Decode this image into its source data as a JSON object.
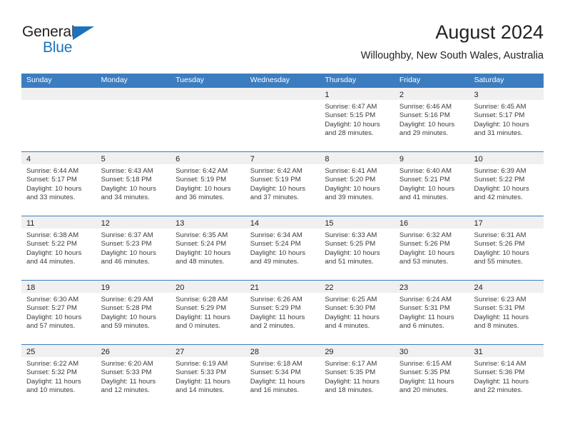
{
  "brand": {
    "name_top": "General",
    "name_bottom": "Blue",
    "accent_color": "#1c72bd"
  },
  "header": {
    "title": "August 2024",
    "subtitle": "Willoughby, New South Wales, Australia"
  },
  "theme": {
    "header_blue": "#3c7dc0",
    "day_band_gray": "#f0f0f0",
    "text_color": "#231f20"
  },
  "weekdays": [
    "Sunday",
    "Monday",
    "Tuesday",
    "Wednesday",
    "Thursday",
    "Friday",
    "Saturday"
  ],
  "weeks": [
    [
      {
        "day": "",
        "empty": true
      },
      {
        "day": "",
        "empty": true
      },
      {
        "day": "",
        "empty": true
      },
      {
        "day": "",
        "empty": true
      },
      {
        "day": "1",
        "sunrise": "Sunrise: 6:47 AM",
        "sunset": "Sunset: 5:15 PM",
        "daylight_1": "Daylight: 10 hours",
        "daylight_2": "and 28 minutes."
      },
      {
        "day": "2",
        "sunrise": "Sunrise: 6:46 AM",
        "sunset": "Sunset: 5:16 PM",
        "daylight_1": "Daylight: 10 hours",
        "daylight_2": "and 29 minutes."
      },
      {
        "day": "3",
        "sunrise": "Sunrise: 6:45 AM",
        "sunset": "Sunset: 5:17 PM",
        "daylight_1": "Daylight: 10 hours",
        "daylight_2": "and 31 minutes."
      }
    ],
    [
      {
        "day": "4",
        "sunrise": "Sunrise: 6:44 AM",
        "sunset": "Sunset: 5:17 PM",
        "daylight_1": "Daylight: 10 hours",
        "daylight_2": "and 33 minutes."
      },
      {
        "day": "5",
        "sunrise": "Sunrise: 6:43 AM",
        "sunset": "Sunset: 5:18 PM",
        "daylight_1": "Daylight: 10 hours",
        "daylight_2": "and 34 minutes."
      },
      {
        "day": "6",
        "sunrise": "Sunrise: 6:42 AM",
        "sunset": "Sunset: 5:19 PM",
        "daylight_1": "Daylight: 10 hours",
        "daylight_2": "and 36 minutes."
      },
      {
        "day": "7",
        "sunrise": "Sunrise: 6:42 AM",
        "sunset": "Sunset: 5:19 PM",
        "daylight_1": "Daylight: 10 hours",
        "daylight_2": "and 37 minutes."
      },
      {
        "day": "8",
        "sunrise": "Sunrise: 6:41 AM",
        "sunset": "Sunset: 5:20 PM",
        "daylight_1": "Daylight: 10 hours",
        "daylight_2": "and 39 minutes."
      },
      {
        "day": "9",
        "sunrise": "Sunrise: 6:40 AM",
        "sunset": "Sunset: 5:21 PM",
        "daylight_1": "Daylight: 10 hours",
        "daylight_2": "and 41 minutes."
      },
      {
        "day": "10",
        "sunrise": "Sunrise: 6:39 AM",
        "sunset": "Sunset: 5:22 PM",
        "daylight_1": "Daylight: 10 hours",
        "daylight_2": "and 42 minutes."
      }
    ],
    [
      {
        "day": "11",
        "sunrise": "Sunrise: 6:38 AM",
        "sunset": "Sunset: 5:22 PM",
        "daylight_1": "Daylight: 10 hours",
        "daylight_2": "and 44 minutes."
      },
      {
        "day": "12",
        "sunrise": "Sunrise: 6:37 AM",
        "sunset": "Sunset: 5:23 PM",
        "daylight_1": "Daylight: 10 hours",
        "daylight_2": "and 46 minutes."
      },
      {
        "day": "13",
        "sunrise": "Sunrise: 6:35 AM",
        "sunset": "Sunset: 5:24 PM",
        "daylight_1": "Daylight: 10 hours",
        "daylight_2": "and 48 minutes."
      },
      {
        "day": "14",
        "sunrise": "Sunrise: 6:34 AM",
        "sunset": "Sunset: 5:24 PM",
        "daylight_1": "Daylight: 10 hours",
        "daylight_2": "and 49 minutes."
      },
      {
        "day": "15",
        "sunrise": "Sunrise: 6:33 AM",
        "sunset": "Sunset: 5:25 PM",
        "daylight_1": "Daylight: 10 hours",
        "daylight_2": "and 51 minutes."
      },
      {
        "day": "16",
        "sunrise": "Sunrise: 6:32 AM",
        "sunset": "Sunset: 5:26 PM",
        "daylight_1": "Daylight: 10 hours",
        "daylight_2": "and 53 minutes."
      },
      {
        "day": "17",
        "sunrise": "Sunrise: 6:31 AM",
        "sunset": "Sunset: 5:26 PM",
        "daylight_1": "Daylight: 10 hours",
        "daylight_2": "and 55 minutes."
      }
    ],
    [
      {
        "day": "18",
        "sunrise": "Sunrise: 6:30 AM",
        "sunset": "Sunset: 5:27 PM",
        "daylight_1": "Daylight: 10 hours",
        "daylight_2": "and 57 minutes."
      },
      {
        "day": "19",
        "sunrise": "Sunrise: 6:29 AM",
        "sunset": "Sunset: 5:28 PM",
        "daylight_1": "Daylight: 10 hours",
        "daylight_2": "and 59 minutes."
      },
      {
        "day": "20",
        "sunrise": "Sunrise: 6:28 AM",
        "sunset": "Sunset: 5:29 PM",
        "daylight_1": "Daylight: 11 hours",
        "daylight_2": "and 0 minutes."
      },
      {
        "day": "21",
        "sunrise": "Sunrise: 6:26 AM",
        "sunset": "Sunset: 5:29 PM",
        "daylight_1": "Daylight: 11 hours",
        "daylight_2": "and 2 minutes."
      },
      {
        "day": "22",
        "sunrise": "Sunrise: 6:25 AM",
        "sunset": "Sunset: 5:30 PM",
        "daylight_1": "Daylight: 11 hours",
        "daylight_2": "and 4 minutes."
      },
      {
        "day": "23",
        "sunrise": "Sunrise: 6:24 AM",
        "sunset": "Sunset: 5:31 PM",
        "daylight_1": "Daylight: 11 hours",
        "daylight_2": "and 6 minutes."
      },
      {
        "day": "24",
        "sunrise": "Sunrise: 6:23 AM",
        "sunset": "Sunset: 5:31 PM",
        "daylight_1": "Daylight: 11 hours",
        "daylight_2": "and 8 minutes."
      }
    ],
    [
      {
        "day": "25",
        "sunrise": "Sunrise: 6:22 AM",
        "sunset": "Sunset: 5:32 PM",
        "daylight_1": "Daylight: 11 hours",
        "daylight_2": "and 10 minutes."
      },
      {
        "day": "26",
        "sunrise": "Sunrise: 6:20 AM",
        "sunset": "Sunset: 5:33 PM",
        "daylight_1": "Daylight: 11 hours",
        "daylight_2": "and 12 minutes."
      },
      {
        "day": "27",
        "sunrise": "Sunrise: 6:19 AM",
        "sunset": "Sunset: 5:33 PM",
        "daylight_1": "Daylight: 11 hours",
        "daylight_2": "and 14 minutes."
      },
      {
        "day": "28",
        "sunrise": "Sunrise: 6:18 AM",
        "sunset": "Sunset: 5:34 PM",
        "daylight_1": "Daylight: 11 hours",
        "daylight_2": "and 16 minutes."
      },
      {
        "day": "29",
        "sunrise": "Sunrise: 6:17 AM",
        "sunset": "Sunset: 5:35 PM",
        "daylight_1": "Daylight: 11 hours",
        "daylight_2": "and 18 minutes."
      },
      {
        "day": "30",
        "sunrise": "Sunrise: 6:15 AM",
        "sunset": "Sunset: 5:35 PM",
        "daylight_1": "Daylight: 11 hours",
        "daylight_2": "and 20 minutes."
      },
      {
        "day": "31",
        "sunrise": "Sunrise: 6:14 AM",
        "sunset": "Sunset: 5:36 PM",
        "daylight_1": "Daylight: 11 hours",
        "daylight_2": "and 22 minutes."
      }
    ]
  ]
}
